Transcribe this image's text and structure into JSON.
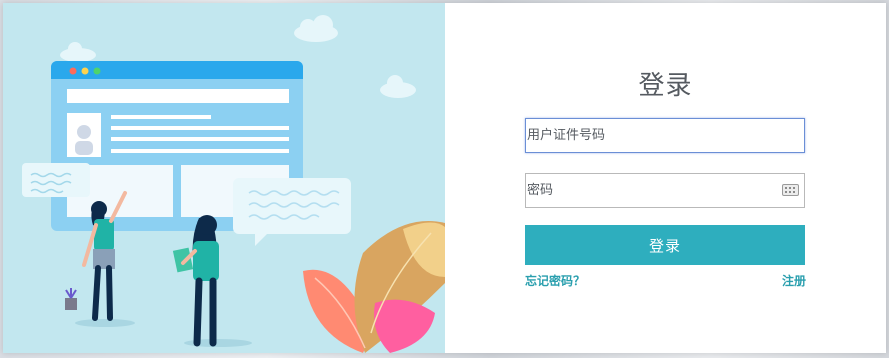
{
  "login": {
    "title": "登录",
    "username_placeholder": "用户证件号码",
    "password_placeholder": "密码",
    "submit_label": "登录",
    "forgot_label": "忘记密码？",
    "register_label": "注册"
  },
  "icons": {
    "keyboard": "keyboard-icon"
  },
  "colors": {
    "accent": "#2eaebe",
    "link": "#2a9fae",
    "illustration_bg": "#c2e7ef",
    "focus_border": "#6b8fd6"
  }
}
